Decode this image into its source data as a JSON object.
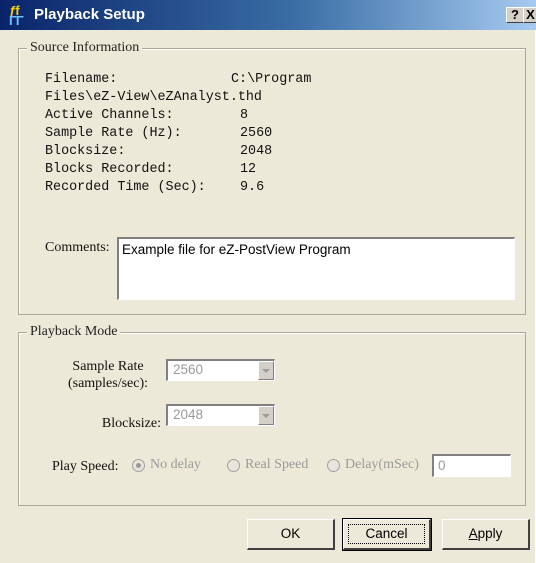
{
  "window": {
    "title": "Playback Setup",
    "icon_name": "app-icon",
    "help_label": "?",
    "close_label": "X"
  },
  "source": {
    "legend": "Source Information",
    "filename_label": "Filename:",
    "filename_value": "C:\\Program",
    "filename_cont": "Files\\eZ-View\\eZAnalyst.thd",
    "active_channels_label": "Active Channels:",
    "active_channels_value": "8",
    "sample_rate_label": "Sample Rate (Hz):",
    "sample_rate_value": "2560",
    "blocksize_label": "Blocksize:",
    "blocksize_value": "2048",
    "blocks_recorded_label": "Blocks Recorded:",
    "blocks_recorded_value": "12",
    "recorded_time_label": "Recorded Time (Sec):",
    "recorded_time_value": "9.6",
    "comments_label": "Comments:",
    "comments_value": "Example file for eZ-PostView Program"
  },
  "playback": {
    "legend": "Playback Mode",
    "sample_rate_label_1": "Sample Rate",
    "sample_rate_label_2": "(samples/sec):",
    "sample_rate_value": "2560",
    "blocksize_label": "Blocksize:",
    "blocksize_value": "2048",
    "play_speed_label": "Play Speed:",
    "options": [
      "No delay",
      "Real Speed",
      "Delay(mSec)"
    ],
    "selected_option": "No delay",
    "delay_value": "0"
  },
  "buttons": {
    "ok": "OK",
    "cancel": "Cancel",
    "apply": "Apply"
  }
}
